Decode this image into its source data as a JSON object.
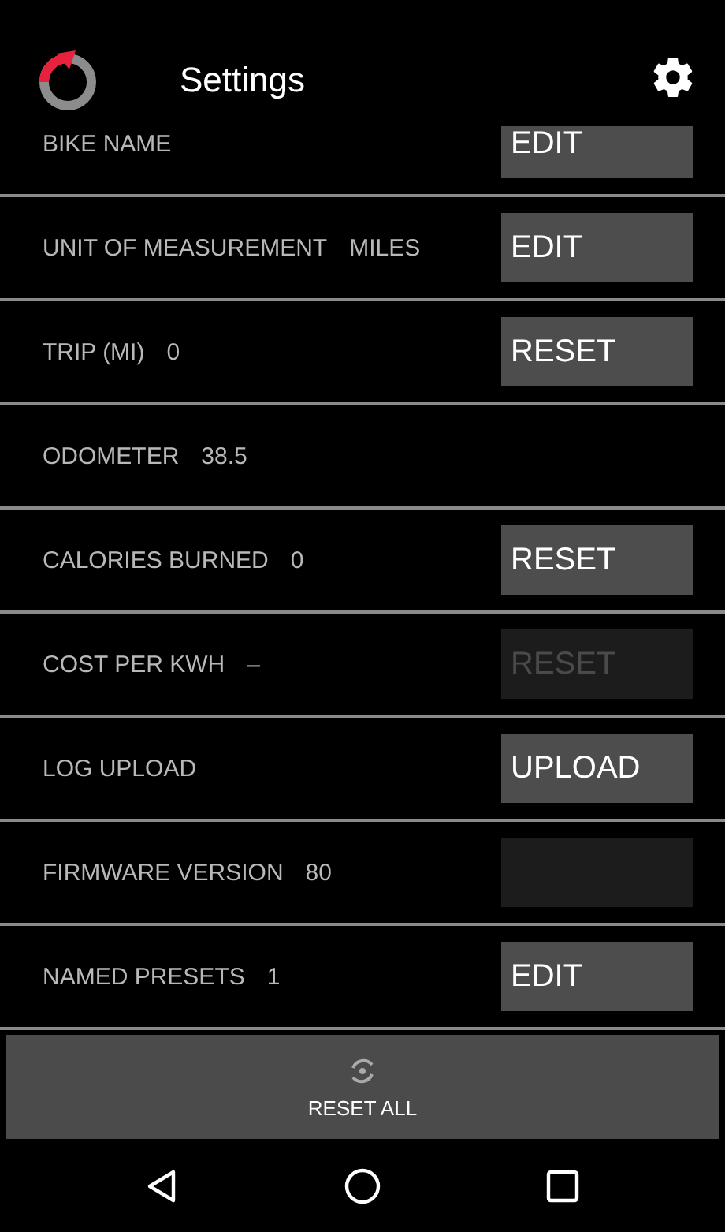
{
  "app_bar": {
    "title": "Settings"
  },
  "settings": [
    {
      "label": "BIKE NAME",
      "button": {
        "label": "EDIT",
        "disabled": false
      },
      "clipped": true
    },
    {
      "label": "UNIT OF MEASUREMENT",
      "value": "MILES",
      "button": {
        "label": "EDIT",
        "disabled": false
      }
    },
    {
      "label": "TRIP (MI)",
      "value": "0",
      "button": {
        "label": "RESET",
        "disabled": false
      }
    },
    {
      "label": "ODOMETER",
      "value": "38.5"
    },
    {
      "label": "CALORIES BURNED",
      "value": "0",
      "button": {
        "label": "RESET",
        "disabled": false
      }
    },
    {
      "label": "COST PER KWH",
      "value": "–",
      "button": {
        "label": "RESET",
        "disabled": true
      }
    },
    {
      "label": "LOG UPLOAD",
      "button": {
        "label": "UPLOAD",
        "disabled": false
      }
    },
    {
      "label": "FIRMWARE VERSION",
      "value": "80",
      "button": {
        "disabled": true
      }
    },
    {
      "label": "NAMED PRESETS",
      "value": "1",
      "button": {
        "label": "EDIT",
        "disabled": false
      }
    }
  ],
  "reset_all": {
    "label": "RESET ALL"
  }
}
